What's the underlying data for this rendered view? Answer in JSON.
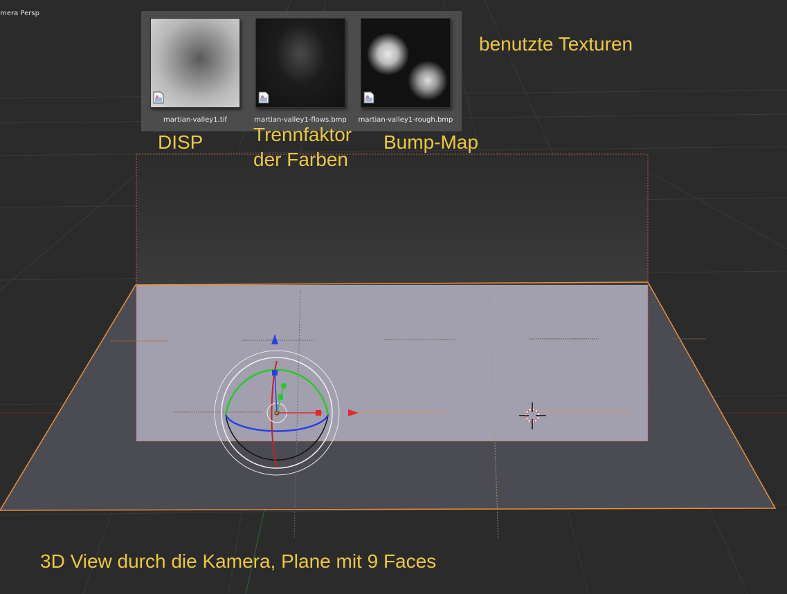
{
  "viewport": {
    "view_label": "Camera Persp"
  },
  "textures": [
    {
      "filename": "martian-valley1.tif"
    },
    {
      "filename": "martian-valley1-flows.bmp"
    },
    {
      "filename": "martian-valley1-rough.bmp"
    }
  ],
  "annotations": {
    "used_textures": "benutzte Texturen",
    "disp": "DISP",
    "separation_line1": "Trennfaktor",
    "separation_line2": "der Farben",
    "bump_map": "Bump-Map",
    "caption": "3D View durch die Kamera, Plane mit 9 Faces"
  },
  "colors": {
    "annotation_text": "#ecc741",
    "background": "#2b2b2b",
    "plane_near": "#4b4b53",
    "plane_rendered": "#a2a0af",
    "selection_outline": "#e8913a",
    "axis_x": "#e52828",
    "axis_y": "#28c828",
    "axis_z": "#2a40e6"
  },
  "icons": {
    "image_file": "image-file-icon",
    "cursor_3d": "3d-cursor-icon",
    "manipulator": "rotate-manipulator-gizmo"
  }
}
